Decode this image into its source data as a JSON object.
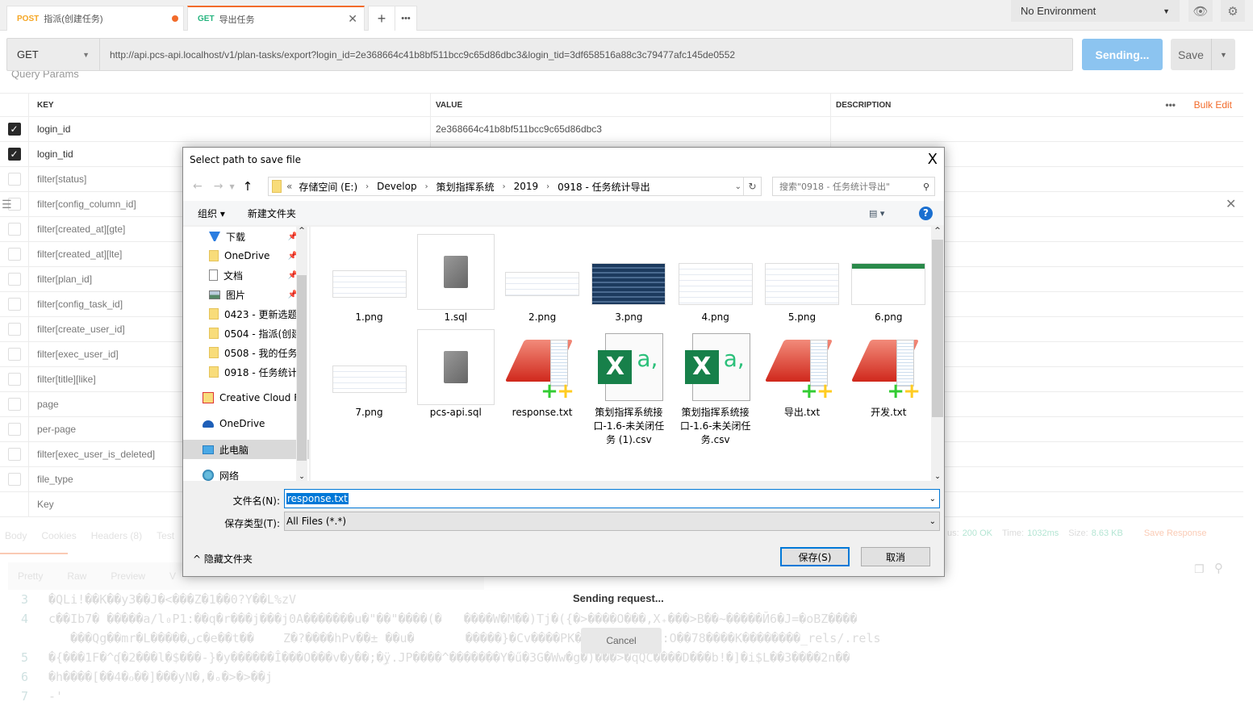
{
  "tabs": [
    {
      "method": "POST",
      "name": "指派(创建任务)",
      "method_color": "#f5a623",
      "unsaved": true
    },
    {
      "method": "GET",
      "name": "导出任务",
      "method_color": "#26b47f",
      "active": true
    }
  ],
  "tab_actions": {
    "new": "+",
    "more": "•••",
    "close": "✕"
  },
  "environment": {
    "selected": "No Environment"
  },
  "request": {
    "method": "GET",
    "url": "http://api.pcs-api.localhost/v1/plan-tasks/export?login_id=2e368664c41b8bf511bcc9c65d86dbc3&login_tid=3df658516a88c3c79477afc145de0552",
    "send_label": "Sending...",
    "save_label": "Save"
  },
  "params": {
    "section": "Query Params",
    "headers": {
      "key": "KEY",
      "value": "VALUE",
      "description": "DESCRIPTION"
    },
    "bulk_edit": "Bulk Edit",
    "more": "•••",
    "rows": [
      {
        "key": "login_id",
        "value": "2e368664c41b8bf511bcc9c65d86dbc3",
        "checked": true
      },
      {
        "key": "login_tid",
        "value": "",
        "checked": true
      },
      {
        "key": "filter[status]",
        "checked": false
      },
      {
        "key": "filter[config_column_id]",
        "checked": false
      },
      {
        "key": "filter[created_at][gte]",
        "checked": false
      },
      {
        "key": "filter[created_at][lte]",
        "checked": false
      },
      {
        "key": "filter[plan_id]",
        "checked": false
      },
      {
        "key": "filter[config_task_id]",
        "checked": false
      },
      {
        "key": "filter[create_user_id]",
        "checked": false
      },
      {
        "key": "filter[exec_user_id]",
        "checked": false
      },
      {
        "key": "filter[title][like]",
        "checked": false
      },
      {
        "key": "page",
        "checked": false
      },
      {
        "key": "per-page",
        "checked": false
      },
      {
        "key": "filter[exec_user_is_deleted]",
        "checked": false
      },
      {
        "key": "file_type",
        "checked": false
      }
    ],
    "placeholder_key": "Key"
  },
  "response": {
    "tabs": [
      "Body",
      "Cookies",
      "Headers (8)",
      "Test"
    ],
    "views": [
      "Pretty",
      "Raw",
      "Preview",
      "V"
    ],
    "status_label": "us:",
    "status": "200 OK",
    "time_label": "Time:",
    "time": "1032ms",
    "size_label": "Size:",
    "size": "8.63 KB",
    "save_response": "Save Response",
    "lines": [
      {
        "n": "3",
        "t": "�QLi!��K��y3��J�<���Z�1��0?Y��L%zV"
      },
      {
        "n": "4",
        "t": "c��Ib7� �����a/l₀P1:��q�r���j���j0A�������u�\"��\"����(�   ����W�M��)Tj�({�>����O���,X₊���>B��~�����Й6�J=�oBZ����"
      },
      {
        "n": "",
        "t": "   ���Qg��mr�L�����ںc�e��t��    Z�?����hPv��± ��u�       �����}�Cv����PK�����������R:O��78����K��������_rels/.rels"
      },
      {
        "n": "5",
        "t": "�{���1F�^ʠ�2���l�$���-}�y������Î���O���v�y��;�ۣÿ.JP����^�������Y�ű�3G�Ww�g�)���>�qQC����D���b!�]�i$L��3����2n��"
      },
      {
        "n": "6",
        "t": "�h����[��4�ℴ��]���yN�,�ₒ�>�>��j"
      },
      {
        "n": "7",
        "t": "-'"
      }
    ],
    "sending": "Sending request...",
    "cancel": "Cancel"
  },
  "dialog": {
    "title": "Select path to save file",
    "close": "X",
    "breadcrumb": [
      "存储空间 (E:)",
      "Develop",
      "策划指挥系统",
      "2019",
      "0918 - 任务统计导出"
    ],
    "search_placeholder": "搜索\"0918 - 任务统计导出\"",
    "toolbar": {
      "organize": "组织 ▾",
      "new_folder": "新建文件夹",
      "help": "?"
    },
    "nav": [
      {
        "label": "下载",
        "icon": "download-icon",
        "pinned": true
      },
      {
        "label": "OneDrive",
        "icon": "folder-icon",
        "pinned": true
      },
      {
        "label": "文档",
        "icon": "document-icon",
        "pinned": true
      },
      {
        "label": "图片",
        "icon": "picture-icon",
        "pinned": true
      },
      {
        "label": "0423 - 更新选题",
        "icon": "folder-icon"
      },
      {
        "label": "0504 - 指派(创建",
        "icon": "folder-icon"
      },
      {
        "label": "0508 - 我的任务",
        "icon": "folder-icon"
      },
      {
        "label": "0918 - 任务统计",
        "icon": "folder-icon"
      },
      {
        "label": "Creative Cloud F",
        "icon": "creative-cloud-icon"
      },
      {
        "label": "OneDrive",
        "icon": "cloud-icon"
      },
      {
        "label": "此电脑",
        "icon": "computer-icon",
        "selected": true
      },
      {
        "label": "网络",
        "icon": "network-icon"
      }
    ],
    "files": [
      {
        "name": "1.png",
        "type": "image"
      },
      {
        "name": "1.sql",
        "type": "sql"
      },
      {
        "name": "2.png",
        "type": "image"
      },
      {
        "name": "3.png",
        "type": "image-dark"
      },
      {
        "name": "4.png",
        "type": "image"
      },
      {
        "name": "5.png",
        "type": "image"
      },
      {
        "name": "6.png",
        "type": "image-green"
      },
      {
        "name": "7.png",
        "type": "image"
      },
      {
        "name": "pcs-api.sql",
        "type": "sql"
      },
      {
        "name": "response.txt",
        "type": "txt"
      },
      {
        "name": "策划指挥系统接口-1.6-未关闭任务 (1).csv",
        "type": "csv"
      },
      {
        "name": "策划指挥系统接口-1.6-未关闭任务.csv",
        "type": "csv"
      },
      {
        "name": "导出.txt",
        "type": "txt"
      },
      {
        "name": "开发.txt",
        "type": "txt"
      }
    ],
    "filename_label": "文件名(N):",
    "filename": "response.txt",
    "filetype_label": "保存类型(T):",
    "filetype": "All Files (*.*)",
    "hide_folders": "隐藏文件夹",
    "save": "保存(S)",
    "cancel": "取消"
  }
}
